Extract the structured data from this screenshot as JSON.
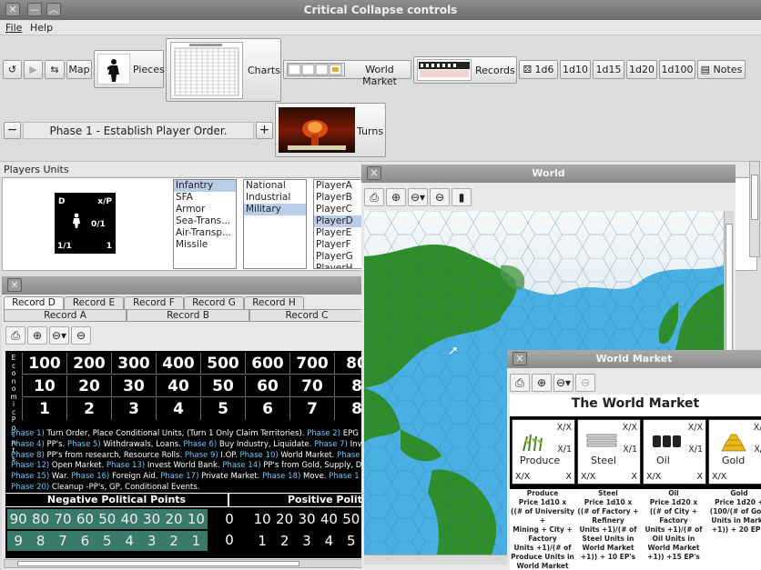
{
  "main_window": {
    "title": "Critical Collapse controls"
  },
  "menu": [
    "File",
    "Help"
  ],
  "toolbar": {
    "map": "Map",
    "pieces": "Pieces",
    "charts": "Charts",
    "world_market": "World Market",
    "records": "Records",
    "dice": [
      "1d6",
      "1d10",
      "1d15",
      "1d20",
      "1d100"
    ],
    "notes": "Notes"
  },
  "phase": {
    "label": "Phase 1 - Establish Player Order.",
    "turns": "Turns",
    "minus": "−",
    "plus": "+"
  },
  "players_units": {
    "label": "Players Units",
    "counter": {
      "tl": "D",
      "tr": "x/P",
      "mid": "0/1",
      "bl": "1/1",
      "br": "1"
    },
    "unit_types": [
      "Infantry",
      "SFA",
      "Armor",
      "Sea-Trans...",
      "Air-Transp...",
      "Missile"
    ],
    "unit_types_selected": 0,
    "classes": [
      "National",
      "Industrial",
      "Military"
    ],
    "classes_selected": 2,
    "players": [
      "PlayerA",
      "PlayerB",
      "PlayerC",
      "PlayerD",
      "PlayerE",
      "PlayerF",
      "PlayerG",
      "PlayerH"
    ],
    "players_selected": 3
  },
  "record_window": {
    "tabs_top": [
      "Record D",
      "Record E",
      "Record F",
      "Record G",
      "Record H"
    ],
    "tabs_bottom": [
      "Record A",
      "Record B",
      "Record C"
    ],
    "side_text": "Economic Points",
    "econ_rows": [
      [
        "100",
        "200",
        "300",
        "400",
        "500",
        "600",
        "700",
        "80"
      ],
      [
        "10",
        "20",
        "30",
        "40",
        "50",
        "60",
        "70",
        "8"
      ],
      [
        "1",
        "2",
        "3",
        "4",
        "5",
        "6",
        "7",
        "8"
      ]
    ],
    "phase_lines": [
      [
        [
          "Phase 1)",
          true
        ],
        [
          " Turn Order, Place Conditional Units, (Turn 1 Only Claim Territories). ",
          false
        ],
        [
          "Phase 2)",
          true
        ],
        [
          " EPG",
          false
        ]
      ],
      [
        [
          "Phase 4)",
          true
        ],
        [
          " PP's. ",
          false
        ],
        [
          "Phase 5)",
          true
        ],
        [
          " Withdrawals, Loans. ",
          false
        ],
        [
          "Phase 6)",
          true
        ],
        [
          " Buy Industry, Liquidate. ",
          false
        ],
        [
          "Phase 7)",
          true
        ],
        [
          " Inv",
          false
        ]
      ],
      [
        [
          "Phase 8)",
          true
        ],
        [
          " PP's from research, Resource Rolls. ",
          false
        ],
        [
          "Phase 9)",
          true
        ],
        [
          " I.OP. ",
          false
        ],
        [
          "Phase 10)",
          true
        ],
        [
          " World Market. ",
          false
        ],
        [
          "Phase",
          true
        ]
      ],
      [
        [
          "Phase 12)",
          true
        ],
        [
          " Open Market. ",
          false
        ],
        [
          "Phase 13)",
          true
        ],
        [
          " Invest World Bank. ",
          false
        ],
        [
          "Phase 14)",
          true
        ],
        [
          " PP's from Gold, Supply, D",
          false
        ]
      ],
      [
        [
          "Phase 15)",
          true
        ],
        [
          " War. ",
          false
        ],
        [
          "Phase 16)",
          true
        ],
        [
          " Foreign Aid. ",
          false
        ],
        [
          "Phase 17)",
          true
        ],
        [
          " Private Market. ",
          false
        ],
        [
          "Phase 18)",
          true
        ],
        [
          " Move. ",
          false
        ],
        [
          "Phase 1",
          true
        ]
      ],
      [
        [
          "Phase 20)",
          true
        ],
        [
          " Cleanup -PP's, GP, Conditional Events.",
          false
        ]
      ]
    ],
    "neg_label": "Negative Political Points",
    "pos_label": "Positive Politic",
    "neg_row1": [
      "90",
      "80",
      "70",
      "60",
      "50",
      "40",
      "30",
      "20",
      "10"
    ],
    "neg_row2": [
      "9",
      "8",
      "7",
      "6",
      "5",
      "4",
      "3",
      "2",
      "1"
    ],
    "zero": "0",
    "pos_row1": [
      "10",
      "20",
      "30",
      "40",
      "50"
    ],
    "pos_row2": [
      "1",
      "2",
      "3",
      "4",
      "5"
    ]
  },
  "world_window": {
    "title": "World"
  },
  "market_window": {
    "title": "World Market",
    "heading": "The World Market",
    "resources": [
      {
        "name": "Produce",
        "desc": [
          "Produce",
          "Price 1d10 x",
          "((# of University +",
          "Mining + City +",
          "Factory",
          "Units +1)/(# of",
          "Produce Units in",
          "World Market",
          "+1)) + 5 EP's"
        ]
      },
      {
        "name": "Steel",
        "desc": [
          "Steel",
          "Price 1d10 x",
          "((# of Factory +",
          "Refinery",
          "Units +1)/(# of",
          "Steel Units in",
          "World Market",
          "+1)) + 10 EP's"
        ]
      },
      {
        "name": "Oil",
        "desc": [
          "Oil",
          "Price 1d20 x",
          "((# of City +",
          "Factory",
          "Units +1)/(# of",
          "Oil Units in",
          "World Market",
          "+1)) +15 EP's"
        ]
      },
      {
        "name": "Gold",
        "desc": [
          "Gold",
          "Price 1d20 +",
          "(100/(# of Gold",
          "Units in Marke",
          "+1)) + 20 EP's"
        ]
      }
    ],
    "card": {
      "xx": "X/X",
      "x1": "X/1",
      "x": "X"
    }
  },
  "colors": {
    "titlebar": "#7c7c7c",
    "ocean": "#4ab0e4",
    "land": "#2f8e2c",
    "highlight": "#66c8ff"
  }
}
